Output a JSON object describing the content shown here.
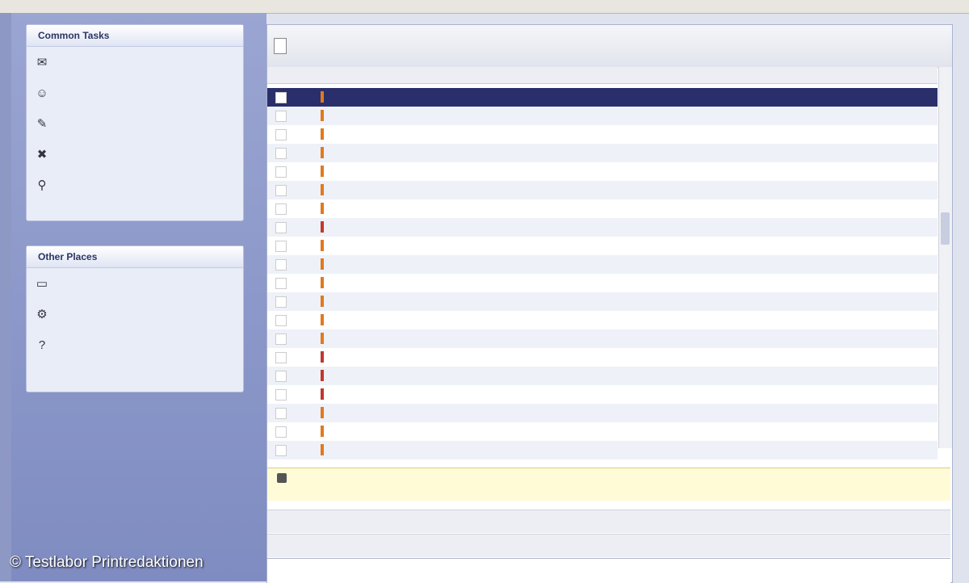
{
  "sidebar": {
    "panels": [
      {
        "title": "Common Tasks",
        "items": [
          {
            "label": "",
            "icon": "mail-icon"
          },
          {
            "label": "",
            "icon": "user-icon"
          },
          {
            "label": "",
            "icon": "compose-icon"
          },
          {
            "label": "",
            "icon": "delete-icon"
          },
          {
            "label": "",
            "icon": "search-icon"
          }
        ]
      },
      {
        "title": "Other Places",
        "items": [
          {
            "label": "",
            "icon": "folder-icon"
          },
          {
            "label": "",
            "icon": "settings-icon"
          },
          {
            "label": "",
            "icon": "help-icon"
          }
        ]
      }
    ]
  },
  "main": {
    "title": "",
    "columns": [
      "",
      "",
      "",
      ""
    ],
    "selected_row": 0,
    "rows": [
      {
        "from": "",
        "subject": "",
        "date": "",
        "flag": "orange"
      },
      {
        "from": "",
        "subject": "",
        "date": "",
        "flag": "orange"
      },
      {
        "from": "",
        "subject": "",
        "date": "",
        "flag": "orange"
      },
      {
        "from": "",
        "subject": "",
        "date": "",
        "flag": "orange"
      },
      {
        "from": "",
        "subject": "",
        "date": "",
        "flag": "orange"
      },
      {
        "from": "",
        "subject": "",
        "date": "",
        "flag": "orange"
      },
      {
        "from": "",
        "subject": "",
        "date": "",
        "flag": "orange"
      },
      {
        "from": "",
        "subject": "",
        "date": "",
        "flag": "red"
      },
      {
        "from": "",
        "subject": "",
        "date": "",
        "flag": "orange"
      },
      {
        "from": "",
        "subject": "",
        "date": "",
        "flag": "orange"
      },
      {
        "from": "",
        "subject": "",
        "date": "",
        "flag": "orange"
      },
      {
        "from": "",
        "subject": "",
        "date": "",
        "flag": "orange"
      },
      {
        "from": "",
        "subject": "",
        "date": "",
        "flag": "orange"
      },
      {
        "from": "",
        "subject": "",
        "date": "",
        "flag": "orange"
      },
      {
        "from": "",
        "subject": "",
        "date": "",
        "flag": "red"
      },
      {
        "from": "",
        "subject": "",
        "date": "",
        "flag": "red"
      },
      {
        "from": "",
        "subject": "",
        "date": "",
        "flag": "red"
      },
      {
        "from": "",
        "subject": "",
        "date": "",
        "flag": "orange"
      },
      {
        "from": "",
        "subject": "",
        "date": "",
        "flag": "orange"
      },
      {
        "from": "",
        "subject": "",
        "date": "",
        "flag": "orange"
      }
    ],
    "infobar": {
      "line1": "",
      "line2": ""
    },
    "header_fields": {
      "from_label": "",
      "from_value": "",
      "to_label": "",
      "subject_label": "",
      "subject_value": "",
      "received_label": "",
      "received_value": ""
    }
  },
  "watermark": "© Testlabor Printredaktionen"
}
